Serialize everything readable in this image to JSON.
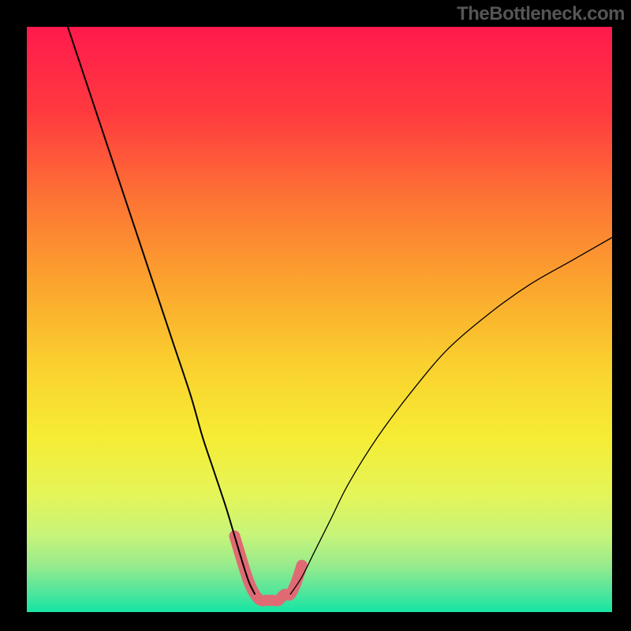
{
  "watermark": "TheBottleneck.com",
  "chart_data": {
    "type": "line",
    "title": "",
    "xlabel": "",
    "ylabel": "",
    "xlim": [
      0,
      100
    ],
    "ylim": [
      0,
      100
    ],
    "grid": false,
    "background_gradient": {
      "stops": [
        {
          "offset": 0.0,
          "color": "#ff1a4d"
        },
        {
          "offset": 0.15,
          "color": "#ff3b3e"
        },
        {
          "offset": 0.3,
          "color": "#fd7634"
        },
        {
          "offset": 0.45,
          "color": "#fba82e"
        },
        {
          "offset": 0.58,
          "color": "#fad12f"
        },
        {
          "offset": 0.7,
          "color": "#f6ec34"
        },
        {
          "offset": 0.8,
          "color": "#e4f559"
        },
        {
          "offset": 0.87,
          "color": "#c6f47a"
        },
        {
          "offset": 0.92,
          "color": "#98eb8c"
        },
        {
          "offset": 0.96,
          "color": "#5ae69a"
        },
        {
          "offset": 1.0,
          "color": "#15e5a4"
        }
      ]
    },
    "series": [
      {
        "name": "curve-left",
        "stroke": "#000000",
        "stroke_width": 2,
        "x": [
          7,
          10,
          13,
          16,
          19,
          22,
          25,
          28,
          30,
          32,
          34,
          35.5,
          37,
          38,
          39
        ],
        "y": [
          100,
          91,
          82,
          73,
          64,
          55,
          46,
          37,
          30,
          24,
          18,
          13,
          8,
          5,
          3
        ]
      },
      {
        "name": "curve-right",
        "stroke": "#000000",
        "stroke_width": 1.3,
        "x": [
          45,
          47,
          49,
          52,
          55,
          60,
          66,
          72,
          79,
          86,
          93,
          100
        ],
        "y": [
          3,
          6,
          10,
          16,
          22,
          30,
          38,
          45,
          51,
          56,
          60,
          64
        ]
      },
      {
        "name": "highlight-good-zone",
        "stroke": "#e06a74",
        "stroke_width": 14,
        "linecap": "round",
        "x": [
          35.5,
          37,
          38,
          39,
          40,
          41,
          42,
          43,
          44,
          45,
          46,
          47
        ],
        "y": [
          13,
          8,
          5,
          3,
          2,
          2,
          2,
          2,
          3,
          3,
          5,
          8
        ]
      }
    ],
    "annotations": []
  }
}
